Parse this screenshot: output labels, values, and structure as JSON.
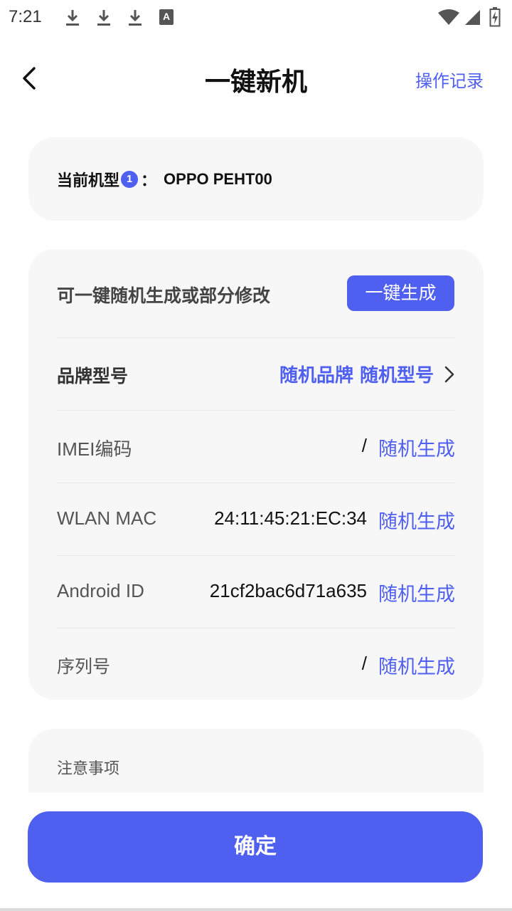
{
  "status_bar": {
    "time": "7:21",
    "icons": [
      "download-icon",
      "download-icon",
      "download-icon",
      "a-letter-icon",
      "wifi-icon",
      "signal-icon",
      "battery-charging-icon"
    ],
    "a_letter": "A"
  },
  "header": {
    "back_icon": "chevron-left-icon",
    "title": "一键新机",
    "history_link": "操作记录"
  },
  "current_model": {
    "label": "当前机型",
    "badge": "1",
    "separator": "：",
    "value": "OPPO PEHT00"
  },
  "info_card": {
    "heading": "可一键随机生成或部分修改",
    "generate_button": "一键生成",
    "rows": [
      {
        "label": "品牌型号",
        "value": "随机品牌 随机型号",
        "action_icon": "chevron-right-icon"
      },
      {
        "label": "IMEI编码",
        "value": "/",
        "action": "随机生成"
      },
      {
        "label": "WLAN MAC",
        "value": "24:11:45:21:EC:34",
        "action": "随机生成"
      },
      {
        "label": "Android ID",
        "value": "21cf2bac6d71a635",
        "action": "随机生成"
      },
      {
        "label": "序列号",
        "value": "/",
        "action": "随机生成"
      }
    ]
  },
  "notes": {
    "title": "注意事项"
  },
  "confirm_button": "确定",
  "colors": {
    "accent": "#4f5ff0",
    "card_bg": "#f7f7f7"
  }
}
